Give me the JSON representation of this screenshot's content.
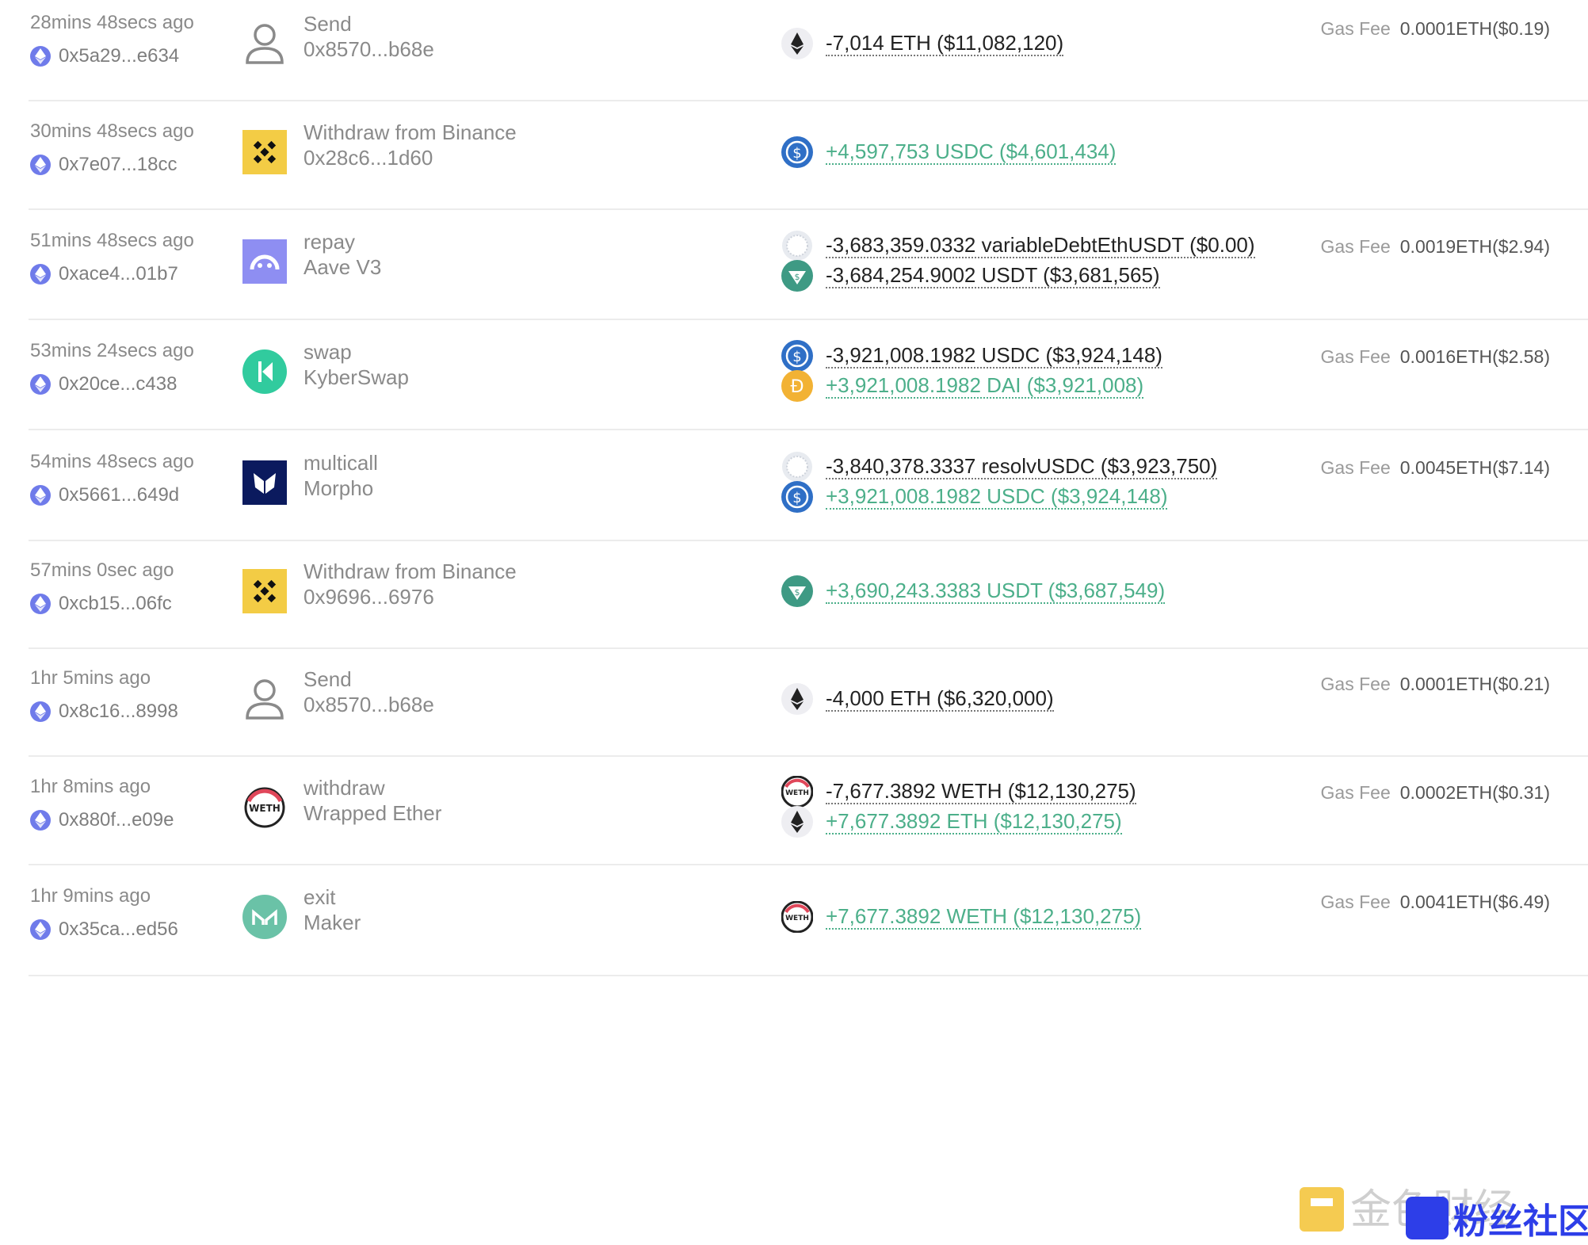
{
  "transactions": [
    {
      "time": "28mins 48secs ago",
      "hash": "0x5a29...e634",
      "entity_icon": "user-icon",
      "action": "Send",
      "sub": "0x8570...b68e",
      "assets": [
        {
          "token": "eth-icon",
          "text": "-7,014 ETH ($11,082,120)",
          "dir": "out"
        }
      ],
      "gas_label": "Gas Fee",
      "gas": "0.0001ETH($0.19)"
    },
    {
      "time": "30mins 48secs ago",
      "hash": "0x7e07...18cc",
      "entity_icon": "binance-icon",
      "action": "Withdraw from Binance",
      "sub": "0x28c6...1d60",
      "assets": [
        {
          "token": "usdc-icon",
          "text": "+4,597,753 USDC ($4,601,434)",
          "dir": "in"
        }
      ],
      "gas_label": "",
      "gas": ""
    },
    {
      "time": "51mins 48secs ago",
      "hash": "0xace4...01b7",
      "entity_icon": "aave-icon",
      "action": "repay",
      "sub": "Aave V3",
      "assets": [
        {
          "token": "generic-token-icon",
          "text": "-3,683,359.0332 variableDebtEthUSDT ($0.00)",
          "dir": "out"
        },
        {
          "token": "usdt-icon",
          "text": "-3,684,254.9002 USDT ($3,681,565)",
          "dir": "out"
        }
      ],
      "gas_label": "Gas Fee",
      "gas": "0.0019ETH($2.94)"
    },
    {
      "time": "53mins 24secs ago",
      "hash": "0x20ce...c438",
      "entity_icon": "kyberswap-icon",
      "action": "swap",
      "sub": "KyberSwap",
      "assets": [
        {
          "token": "usdc-icon",
          "text": "-3,921,008.1982 USDC ($3,924,148)",
          "dir": "out"
        },
        {
          "token": "dai-icon",
          "text": "+3,921,008.1982 DAI ($3,921,008)",
          "dir": "in"
        }
      ],
      "gas_label": "Gas Fee",
      "gas": "0.0016ETH($2.58)"
    },
    {
      "time": "54mins 48secs ago",
      "hash": "0x5661...649d",
      "entity_icon": "morpho-icon",
      "action": "multicall",
      "sub": "Morpho",
      "assets": [
        {
          "token": "generic-token-icon",
          "text": "-3,840,378.3337 resolvUSDC ($3,923,750)",
          "dir": "out"
        },
        {
          "token": "usdc-icon",
          "text": "+3,921,008.1982 USDC ($3,924,148)",
          "dir": "in"
        }
      ],
      "gas_label": "Gas Fee",
      "gas": "0.0045ETH($7.14)"
    },
    {
      "time": "57mins 0sec ago",
      "hash": "0xcb15...06fc",
      "entity_icon": "binance-icon",
      "action": "Withdraw from Binance",
      "sub": "0x9696...6976",
      "assets": [
        {
          "token": "usdt-icon",
          "text": "+3,690,243.3383 USDT ($3,687,549)",
          "dir": "in"
        }
      ],
      "gas_label": "",
      "gas": ""
    },
    {
      "time": "1hr 5mins ago",
      "hash": "0x8c16...8998",
      "entity_icon": "user-icon",
      "action": "Send",
      "sub": "0x8570...b68e",
      "assets": [
        {
          "token": "eth-icon",
          "text": "-4,000 ETH ($6,320,000)",
          "dir": "out"
        }
      ],
      "gas_label": "Gas Fee",
      "gas": "0.0001ETH($0.21)"
    },
    {
      "time": "1hr 8mins ago",
      "hash": "0x880f...e09e",
      "entity_icon": "weth-icon",
      "action": "withdraw",
      "sub": "Wrapped Ether",
      "assets": [
        {
          "token": "weth-icon",
          "text": "-7,677.3892 WETH ($12,130,275)",
          "dir": "out"
        },
        {
          "token": "eth-icon",
          "text": "+7,677.3892 ETH ($12,130,275)",
          "dir": "in"
        }
      ],
      "gas_label": "Gas Fee",
      "gas": "0.0002ETH($0.31)"
    },
    {
      "time": "1hr 9mins ago",
      "hash": "0x35ca...ed56",
      "entity_icon": "maker-icon",
      "action": "exit",
      "sub": "Maker",
      "assets": [
        {
          "token": "weth-icon",
          "text": "+7,677.3892 WETH ($12,130,275)",
          "dir": "in"
        }
      ],
      "gas_label": "Gas Fee",
      "gas": "0.0041ETH($6.49)"
    }
  ],
  "watermark": {
    "text": "金色财经",
    "badge": "粉丝社区"
  },
  "colors": {
    "positive": "#4caf8a",
    "negative": "#222222",
    "divider": "#ececec"
  }
}
